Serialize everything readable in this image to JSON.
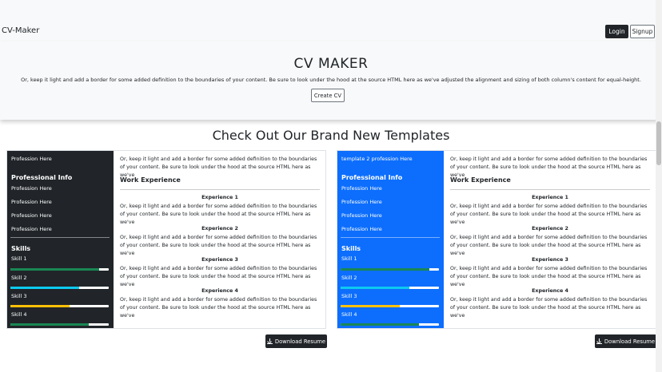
{
  "navbar": {
    "brand": "CV-Maker",
    "login_label": "Login",
    "signup_label": "Signup"
  },
  "hero": {
    "title": "CV MAKER",
    "description": "Or, keep it light and add a border for some added definition to the boundaries of your content. Be sure to look under the hood at the source HTML here as we've adjusted the alignment and sizing of both column's content for equal-height.",
    "create_label": "Create CV"
  },
  "templates": {
    "title": "Check Out Our Brand New Templates",
    "download_label": "Download Resume",
    "cards": [
      {
        "sidebar_color": "#212529",
        "profession_top": "Profession Here",
        "professional_info_title": "Professional Info",
        "professions": [
          "Profession Here",
          "Profession Here",
          "Profession Here",
          "Profession Here"
        ],
        "skills_title": "Skills",
        "skills": [
          {
            "label": "Skill 1",
            "level": 0.9,
            "color": "#198754"
          },
          {
            "label": "Skill 2",
            "level": 0.7,
            "color": "#0dcaf0"
          },
          {
            "label": "Skill 3",
            "level": 0.6,
            "color": "#ffc107"
          },
          {
            "label": "Skill 4",
            "level": 0.8,
            "color": "#198754"
          }
        ],
        "intro": "Or, keep it light and add a border for some added definition to the boundaries of your content. Be sure to look under the hood at the source HTML here as we've",
        "work_title": "Work Experience",
        "experiences": [
          {
            "title": "Experience 1",
            "text": "Or, keep it light and add a border for some added definition to the boundaries of your content. Be sure to look under the hood at the source HTML here as we've"
          },
          {
            "title": "Experience 2",
            "text": "Or, keep it light and add a border for some added definition to the boundaries of your content. Be sure to look under the hood at the source HTML here as we've"
          },
          {
            "title": "Experience 3",
            "text": "Or, keep it light and add a border for some added definition to the boundaries of your content. Be sure to look under the hood at the source HTML here as we've"
          },
          {
            "title": "Experience 4",
            "text": "Or, keep it light and add a border for some added definition to the boundaries of your content. Be sure to look under the hood at the source HTML here as we've"
          }
        ]
      },
      {
        "sidebar_color": "#0d6efd",
        "profession_top": "template 2 profession Here",
        "professional_info_title": "Professional Info",
        "professions": [
          "Profession Here",
          "Profession Here",
          "Profession Here",
          "Profession Here"
        ],
        "skills_title": "Skills",
        "skills": [
          {
            "label": "Skill 1",
            "level": 0.9,
            "color": "#198754"
          },
          {
            "label": "Skill 2",
            "level": 0.7,
            "color": "#0dcaf0"
          },
          {
            "label": "Skill 3",
            "level": 0.6,
            "color": "#ffc107"
          },
          {
            "label": "Skill 4",
            "level": 0.8,
            "color": "#198754"
          }
        ],
        "intro": "Or, keep it light and add a border for some added definition to the boundaries of your content. Be sure to look under the hood at the source HTML here as we've",
        "work_title": "Work Experience",
        "experiences": [
          {
            "title": "Experience 1",
            "text": "Or, keep it light and add a border for some added definition to the boundaries of your content. Be sure to look under the hood at the source HTML here as we've"
          },
          {
            "title": "Experience 2",
            "text": "Or, keep it light and add a border for some added definition to the boundaries of your content. Be sure to look under the hood at the source HTML here as we've"
          },
          {
            "title": "Experience 3",
            "text": "Or, keep it light and add a border for some added definition to the boundaries of your content. Be sure to look under the hood at the source HTML here as we've"
          },
          {
            "title": "Experience 4",
            "text": "Or, keep it light and add a border for some added definition to the boundaries of your content. Be sure to look under the hood at the source HTML here as we've"
          }
        ]
      }
    ]
  },
  "icons": {
    "download": "download-icon"
  }
}
